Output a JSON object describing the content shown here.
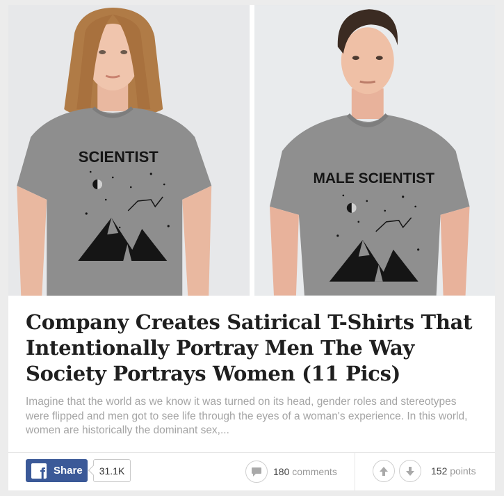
{
  "images": {
    "left": {
      "shirt_text": "SCIENTIST"
    },
    "right": {
      "shirt_text": "MALE SCIENTIST"
    }
  },
  "article": {
    "title": "Company Creates Satirical T-Shirts That Intentionally Portray Men The Way Society Portrays Women (11 Pics)",
    "excerpt": "Imagine that the world as we know it was turned on its head, gender roles and stereotypes were flipped and men got to see life through the eyes of a woman's experience. In this world, women are historically the dominant sex,..."
  },
  "footer": {
    "share_label": "Share",
    "facebook_icon_glyph": "f",
    "share_count": "31.1K",
    "comments_count": "180",
    "comments_label": "comments",
    "points_count": "152",
    "points_label": "points"
  },
  "colors": {
    "facebook": "#3b5998",
    "title": "#1f1f1f",
    "excerpt": "#a4a4a4",
    "shirt": "#8e8e8e"
  },
  "icons": [
    "facebook-icon",
    "comment-bubble-icon",
    "upvote-arrow-icon",
    "downvote-arrow-icon"
  ]
}
